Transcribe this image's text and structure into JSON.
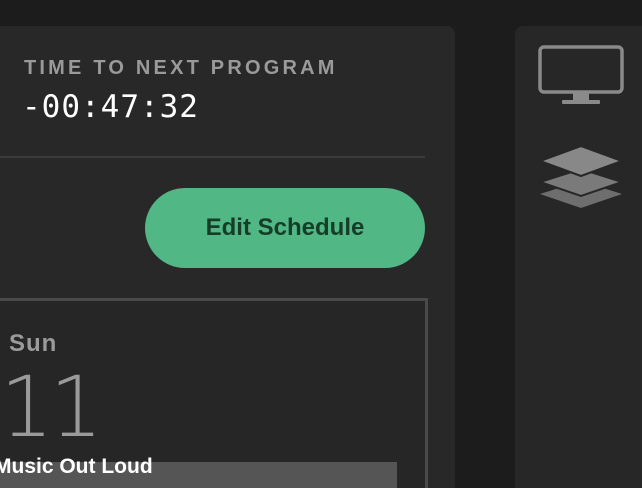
{
  "countdown": {
    "label": "TIME TO NEXT PROGRAM",
    "value": "-00:47:32"
  },
  "actions": {
    "edit_schedule_label": "Edit Schedule"
  },
  "schedule": {
    "day": {
      "name": "Sun",
      "number": "11"
    },
    "programs": [
      {
        "title": "Music Out Loud"
      }
    ]
  },
  "side_nav": {
    "items": [
      {
        "icon": "monitor-icon"
      },
      {
        "icon": "layers-icon"
      }
    ]
  },
  "colors": {
    "background": "#1c1c1c",
    "panel": "#282828",
    "accent": "#51b784",
    "accent_text": "#163d28",
    "muted_text": "#9a9a9a",
    "icon": "#8a8a8a"
  }
}
